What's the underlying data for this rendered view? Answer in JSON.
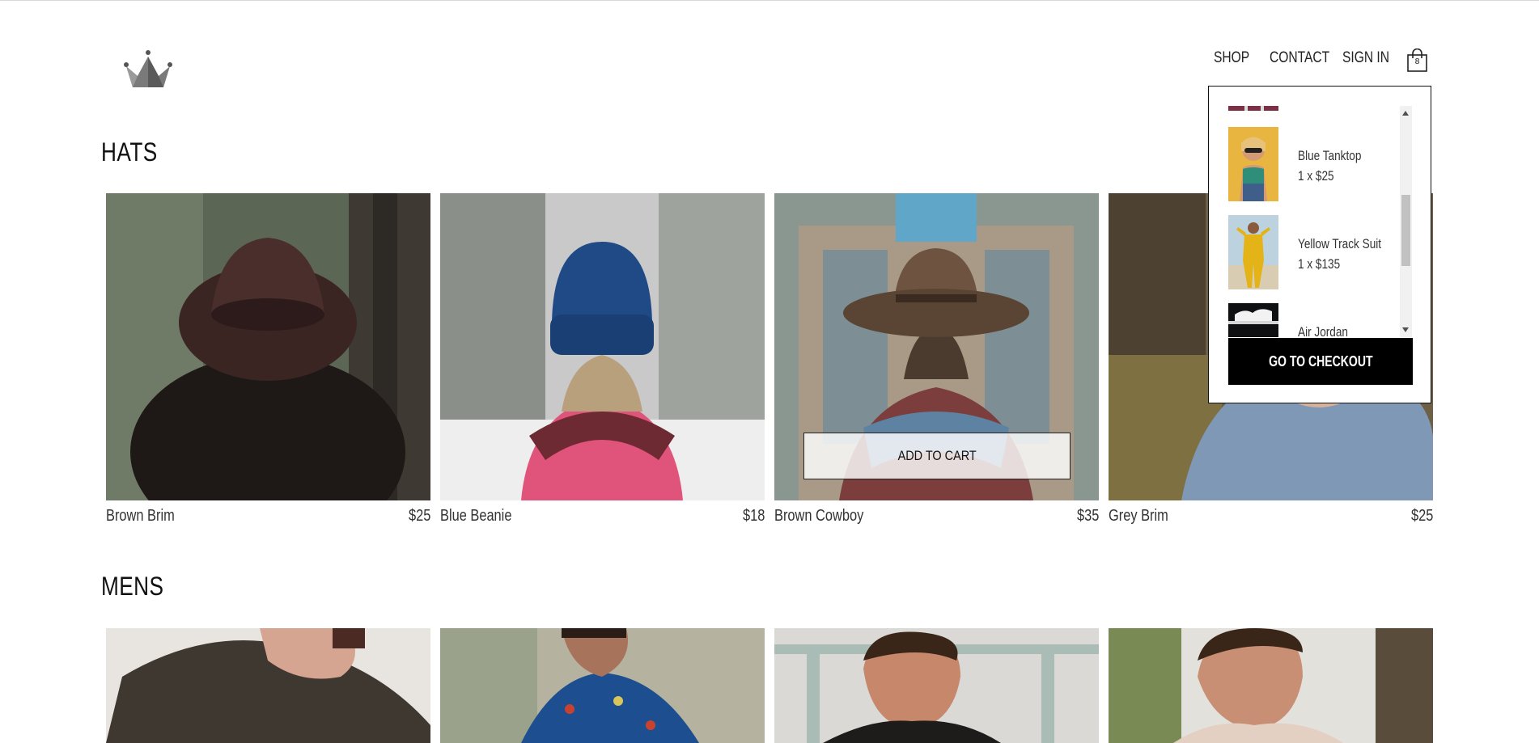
{
  "header": {
    "nav": {
      "shop": "SHOP",
      "contact": "CONTACT",
      "sign_in": "SIGN IN"
    },
    "bag_count": "8",
    "logo_icon": "crown-icon",
    "bag_icon": "shopping-bag-icon"
  },
  "cart_dropdown": {
    "items": [
      {
        "name": "Blue Tanktop",
        "qty_price": "1 x $25"
      },
      {
        "name": "Yellow Track Suit",
        "qty_price": "1 x $135"
      },
      {
        "name": "Air Jordan",
        "qty_price": ""
      }
    ],
    "checkout_label": "GO TO CHECKOUT"
  },
  "sections": {
    "hats": {
      "title": "HATS",
      "add_to_cart_label": "ADD TO CART",
      "products": [
        {
          "name": "Brown Brim",
          "price": "$25"
        },
        {
          "name": "Blue Beanie",
          "price": "$18"
        },
        {
          "name": "Brown Cowboy",
          "price": "$35"
        },
        {
          "name": "Grey Brim",
          "price": "$25"
        }
      ]
    },
    "mens": {
      "title": "MENS"
    }
  },
  "colors": {
    "text": "#111111",
    "checkout_bg": "#000000",
    "border": "#111111"
  }
}
